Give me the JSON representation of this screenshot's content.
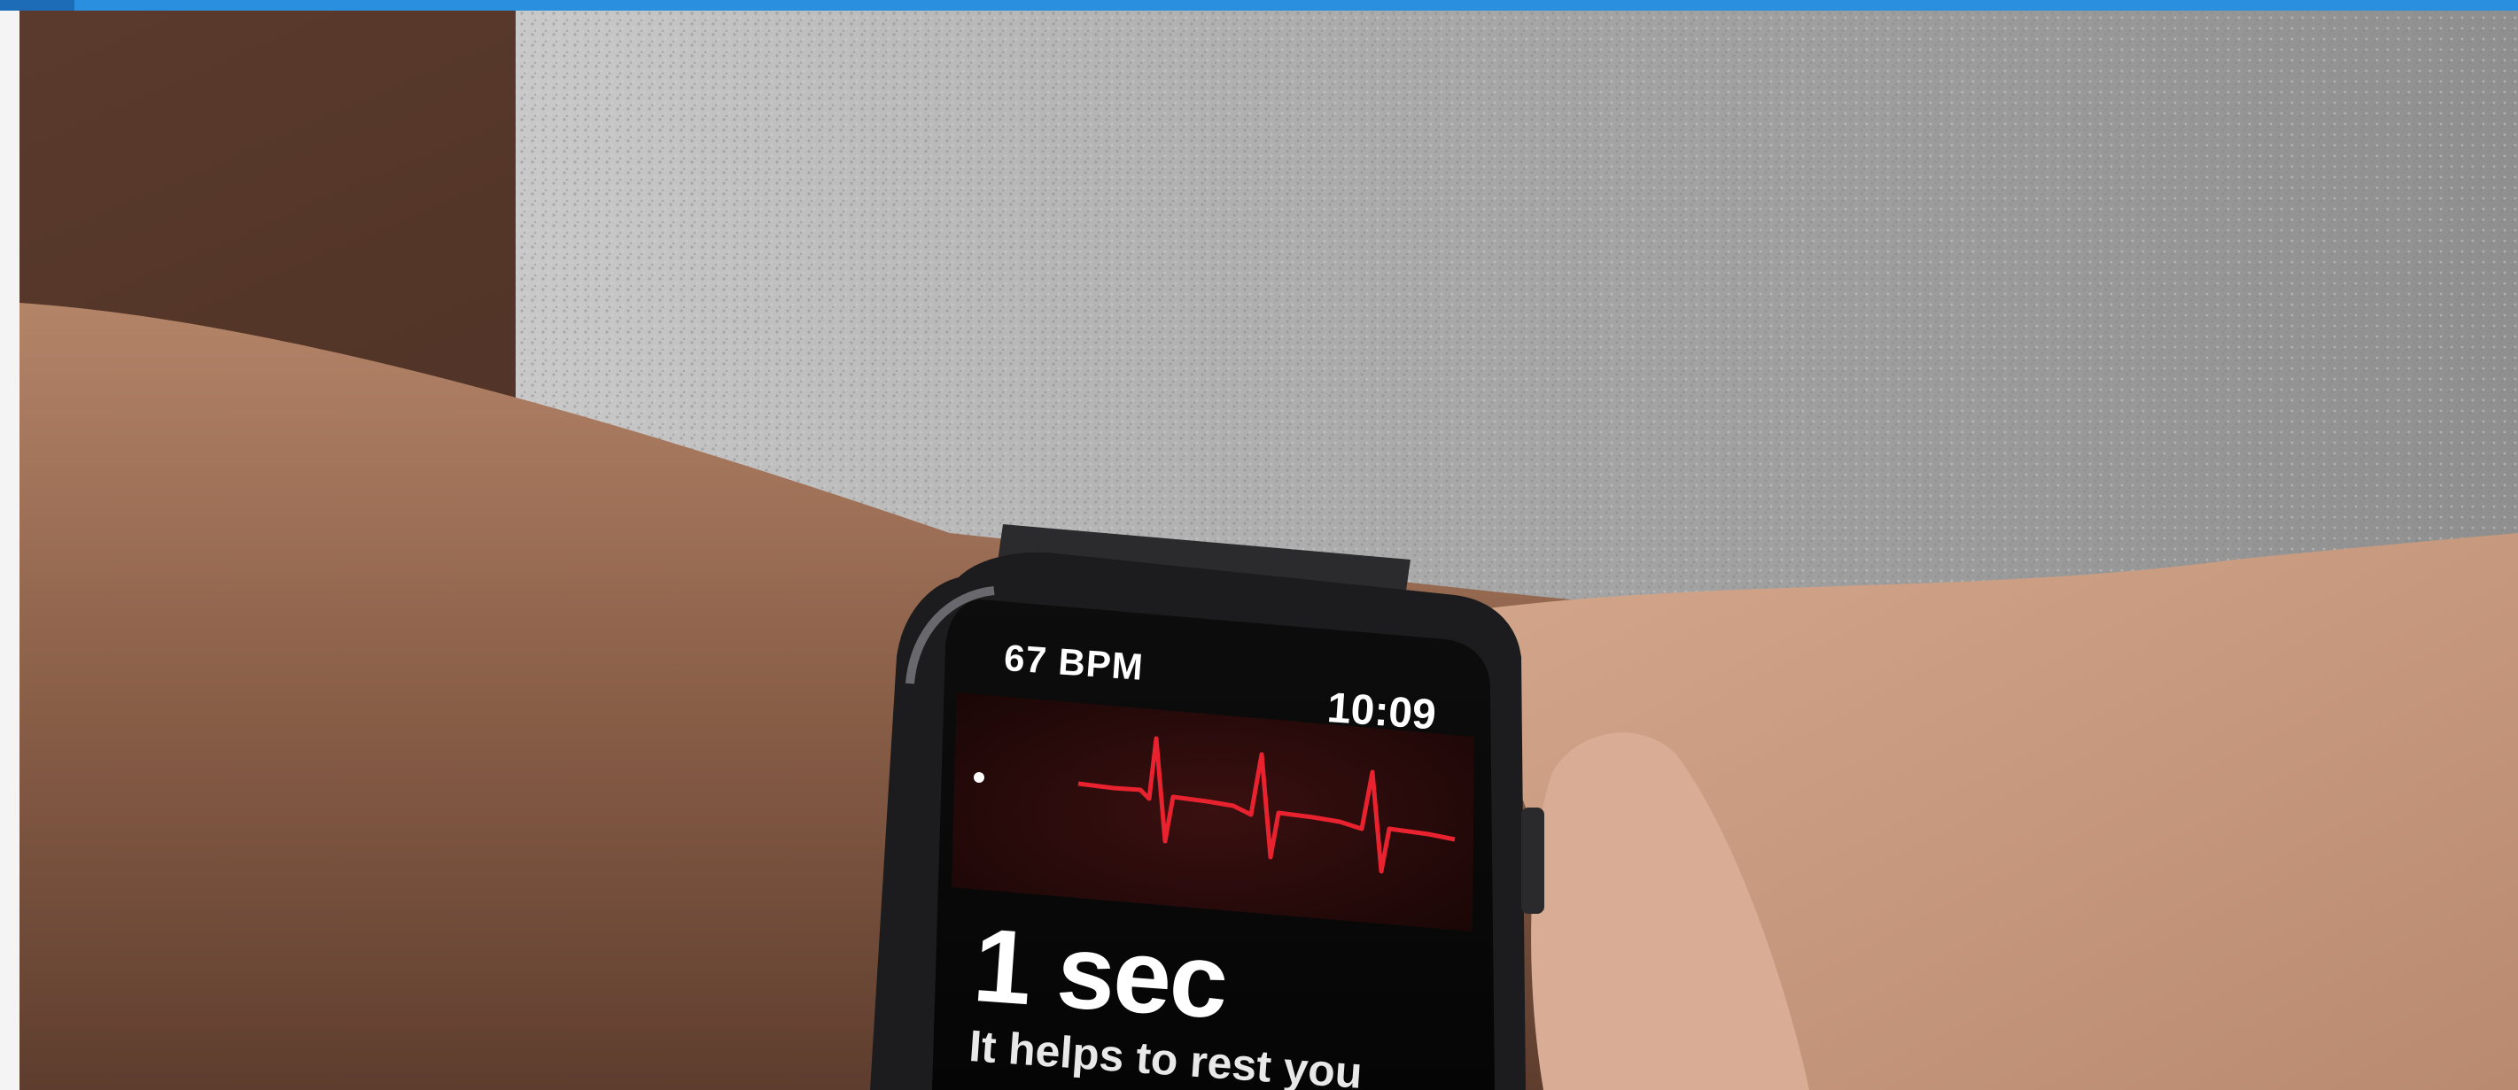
{
  "watch": {
    "heart_rate": "67 BPM",
    "time": "10:09",
    "timer": "1 sec",
    "hint": "It helps to rest you"
  },
  "colors": {
    "top_bar": "#2b8fe0",
    "ecg_trace": "#e8232f",
    "sweater": "#a9a9a9",
    "skin": "#b8876a",
    "watch_body": "#1a1a1a"
  }
}
